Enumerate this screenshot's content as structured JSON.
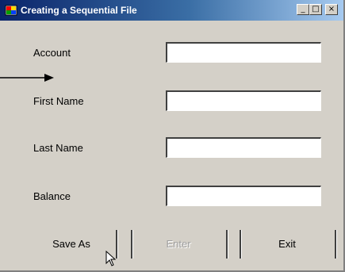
{
  "window": {
    "title": "Creating a Sequential File",
    "icon": "app-icon",
    "controls": {
      "minimize": "_",
      "maximize": "□",
      "close": "×"
    }
  },
  "form": {
    "fields": [
      {
        "label": "Account",
        "value": ""
      },
      {
        "label": "First Name",
        "value": ""
      },
      {
        "label": "Last Name",
        "value": ""
      },
      {
        "label": "Balance",
        "value": ""
      }
    ]
  },
  "buttons": {
    "save_as": "Save As",
    "enter": "Enter",
    "exit": "Exit"
  },
  "annotation": {
    "icon": "arrow-right-icon"
  },
  "colors": {
    "title_bar_start": "#0a246a",
    "title_bar_end": "#a6caf0",
    "window_face": "#d4d0c8",
    "disabled_text": "#a0a0a0"
  }
}
